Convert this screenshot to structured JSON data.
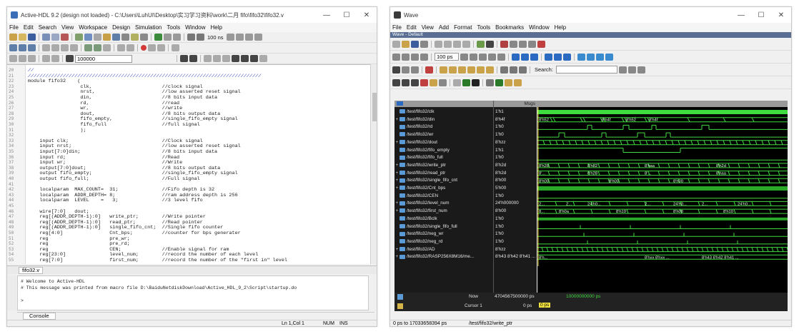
{
  "ahdl": {
    "title": "Active-HDL 9.2 (design not loaded) - C:\\Users\\LuhUI\\Desktop\\实习学习资料\\work\\二月 fifo\\fifo32\\fifo32.v",
    "menu": [
      "File",
      "Edit",
      "Search",
      "View",
      "Workspace",
      "Design",
      "Simulation",
      "Tools",
      "Window",
      "Help"
    ],
    "sim_time": "100 ns",
    "search_value": "100000",
    "code_lines": [
      {
        "n": "20",
        "t": "//",
        "c": true
      },
      {
        "n": "21",
        "t": "////////////////////////////////////////////////////////////////////////////////",
        "c": true
      },
      {
        "n": "22",
        "t": "module fifo32    (",
        "c": false
      },
      {
        "n": "23",
        "t": "                  clk,                        //clock signal",
        "c": false
      },
      {
        "n": "24",
        "t": "                  nrst,                       //low asserted reset signal",
        "c": false
      },
      {
        "n": "25",
        "t": "                  din,                        //8 bits input data",
        "c": false
      },
      {
        "n": "26",
        "t": "                  rd,                         //read",
        "c": false
      },
      {
        "n": "27",
        "t": "                  wr,                         //write",
        "c": false
      },
      {
        "n": "28",
        "t": "                  dout,                       //8 bits output data",
        "c": false
      },
      {
        "n": "29",
        "t": "                  fifo_empty,                 //single_fifo_empty signal",
        "c": false
      },
      {
        "n": "30",
        "t": "                  fifo_full                   //full signal",
        "c": false
      },
      {
        "n": "31",
        "t": "                  );",
        "c": false
      },
      {
        "n": "32",
        "t": "",
        "c": false
      },
      {
        "n": "33",
        "t": "    input clk;                                //Clock signal",
        "c": false
      },
      {
        "n": "34",
        "t": "    input nrst;                               //low asserted reset signal",
        "c": false
      },
      {
        "n": "35",
        "t": "    input[7:0]din;                            //8 bits input data",
        "c": false
      },
      {
        "n": "36",
        "t": "    input rd;                                 //Read",
        "c": false
      },
      {
        "n": "37",
        "t": "    input wr;                                 //Write",
        "c": false
      },
      {
        "n": "38",
        "t": "    output[7:0]dout;                          //8 bits output data",
        "c": false
      },
      {
        "n": "39",
        "t": "    output fifo_empty;                        //single_fifo_empty signal",
        "c": false
      },
      {
        "n": "40",
        "t": "    output fifo_full;                         //Full signal",
        "c": false
      },
      {
        "n": "41",
        "t": "",
        "c": false
      },
      {
        "n": "42",
        "t": "    localparam  MAX_COUNT=  31;               //Fifo depth is 32",
        "c": false
      },
      {
        "n": "43",
        "t": "    localparam  ADDR_DEPTH= 8;                //ram address depth is 256",
        "c": false
      },
      {
        "n": "44",
        "t": "    localparam  LEVEL    =   3;               //3 level fifo",
        "c": false
      },
      {
        "n": "45",
        "t": "",
        "c": false
      },
      {
        "n": "46",
        "t": "    wire[7:0]   dout;",
        "c": false
      },
      {
        "n": "47",
        "t": "    reg[(ADDR_DEPTH-1):0]   write_ptr;        //Write pointer",
        "c": false
      },
      {
        "n": "48",
        "t": "    reg[(ADDR_DEPTH-1):0]   read_ptr;         //Read pointer",
        "c": false
      },
      {
        "n": "49",
        "t": "    reg[(ADDR_DEPTH-1):0]   single_fifo_cnt;  //Single fifo counter",
        "c": false
      },
      {
        "n": "50",
        "t": "    reg[4:0]                Cnt_bps;          //counter for bps generater",
        "c": false
      },
      {
        "n": "51",
        "t": "    reg                     pre_wr;",
        "c": false
      },
      {
        "n": "52",
        "t": "    reg                     pre_rd;",
        "c": false
      },
      {
        "n": "53",
        "t": "    reg                     CEN;              //Enable signal for ram",
        "c": false
      },
      {
        "n": "54",
        "t": "    reg[23:0]               level_num;        //record the number of each level",
        "c": false
      },
      {
        "n": "55",
        "t": "    reg[7:0]                first_num;        //record the number of the \"first in\" level",
        "c": false
      }
    ],
    "file_tab": "fifo32.v",
    "console_lines": [
      "# Welcome to Active-HDL",
      "# This message was printed from macro file D:\\BaiduNetdiskDownload\\Active_HDL_9_2\\Script\\startup.do",
      "",
      ">"
    ],
    "console_tab": "Console",
    "status_pos": "Ln 1,Col 1",
    "status_num": "NUM",
    "status_ins": "INS"
  },
  "wave": {
    "title": "Wave",
    "menu": [
      "File",
      "Edit",
      "View",
      "Add",
      "Format",
      "Tools",
      "Bookmarks",
      "Window",
      "Help"
    ],
    "subtitle": "Wave - Default",
    "time_field": "100 ps",
    "search_label": "Search:",
    "msgs_header": "Msgs",
    "signals": [
      {
        "name": "/test/fifo32/clk",
        "val": "1'h1",
        "exp": false
      },
      {
        "name": "/test/fifo32/din",
        "val": "8'h4f",
        "exp": true
      },
      {
        "name": "/test/fifo32/rd",
        "val": "1'h0",
        "exp": false
      },
      {
        "name": "/test/fifo32/wr",
        "val": "1'h0",
        "exp": false
      },
      {
        "name": "/test/fifo32/dout",
        "val": "8'hzz",
        "exp": true
      },
      {
        "name": "/test/fifo32/fifo_empty",
        "val": "1'h1",
        "exp": false
      },
      {
        "name": "/test/fifo32/fifo_full",
        "val": "1'h0",
        "exp": false
      },
      {
        "name": "/test/fifo32/write_ptr",
        "val": "8'h2d",
        "exp": true
      },
      {
        "name": "/test/fifo32/read_ptr",
        "val": "8'h2d",
        "exp": true
      },
      {
        "name": "/test/fifo32/single_fifo_cnt",
        "val": "8'h00",
        "exp": true
      },
      {
        "name": "/test/fifo32/Cnt_bps",
        "val": "5'h00",
        "exp": true
      },
      {
        "name": "/test/fifo32/CEN",
        "val": "1'h0",
        "exp": false
      },
      {
        "name": "/test/fifo32/level_num",
        "val": "24'h000000",
        "exp": true
      },
      {
        "name": "/test/fifo32/first_num",
        "val": "8'h00",
        "exp": true
      },
      {
        "name": "/test/fifo32/Bclk",
        "val": "1'h0",
        "exp": false
      },
      {
        "name": "/test/fifo32/single_fifo_full",
        "val": "1'h0",
        "exp": false
      },
      {
        "name": "/test/fifo32/neg_wr",
        "val": "1'h0",
        "exp": false
      },
      {
        "name": "/test/fifo32/neg_rd",
        "val": "1'h0",
        "exp": false
      },
      {
        "name": "/test/fifo32/AD",
        "val": "8'hzz",
        "exp": true
      },
      {
        "name": "/test/fifo32/RASP256X8M16/me...",
        "val": "8'h43 8'h42 8'h41 ...",
        "exp": true
      }
    ],
    "bus_labels": {
      "din": [
        "8'h52",
        "8'h4f",
        "8'h52",
        "8'h4f"
      ],
      "write_ptr": [
        "8'h28",
        "8'h82",
        "8'haa",
        "8'h2d"
      ],
      "read_ptr": [
        "8'...",
        "8'h28",
        "8'...",
        "8'haa"
      ],
      "single_fifo_cnt": [
        "8'h00",
        "8'h00",
        "8'h00"
      ],
      "level_num": [
        "2...",
        "2...",
        "24'h0...",
        "2...",
        "24'h0...",
        "2...",
        "24'h0..."
      ],
      "first_num": [
        "8...",
        "8'h0a",
        "8'h10",
        "8'h08",
        "8'h10"
      ],
      "ram": [
        "8'h...",
        "8'hxx 8'hxx ...",
        "8'h43 8'h42 8'h41 ..."
      ]
    },
    "now_label": "Now",
    "now_value": "4704567500000 ps",
    "cursor_label": "Cursor 1",
    "cursor_value": "0 ps",
    "timeline_label": "10000000000 ps",
    "cursor_marker": "0 ps",
    "status_range": "0 ps to 17033658394 ps",
    "status_signal": "/test/fifo32/write_ptr"
  }
}
